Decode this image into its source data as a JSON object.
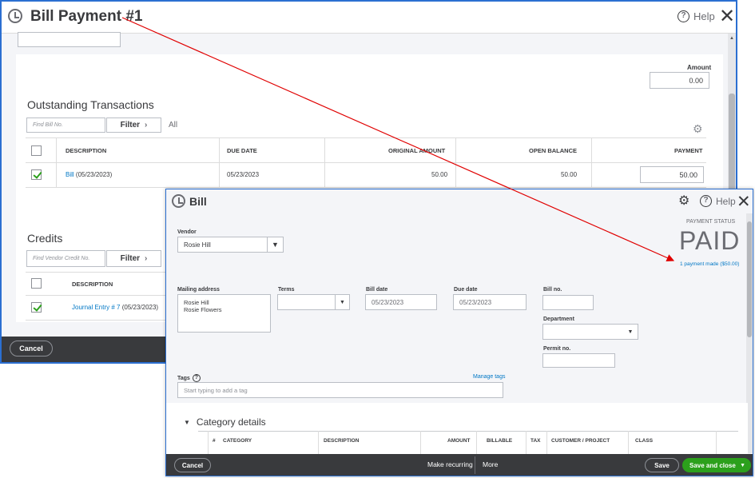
{
  "bill_payment": {
    "title": "Bill Payment #1",
    "help": "Help",
    "close": "✕",
    "amount_label": "Amount",
    "amount_value": "0.00",
    "outstanding_title": "Outstanding Transactions",
    "find_placeholder": "Find Bill No.",
    "filter": "Filter",
    "all": "All",
    "columns": [
      "DESCRIPTION",
      "DUE DATE",
      "ORIGINAL AMOUNT",
      "OPEN BALANCE",
      "PAYMENT"
    ],
    "row": {
      "link": "Bill",
      "link_date": "(05/23/2023)",
      "due": "05/23/2023",
      "original": "50.00",
      "open": "50.00",
      "payment": "50.00"
    },
    "credits_title": "Credits",
    "credit_find_placeholder": "Find Vendor Credit No.",
    "credit_filter": "Filter",
    "credit_column": "DESCRIPTION",
    "credit_row": {
      "link": "Journal Entry # 7",
      "date": "(05/23/2023)"
    },
    "cancel": "Cancel"
  },
  "bill": {
    "title": "Bill",
    "help": "Help",
    "close": "✕",
    "vendor_label": "Vendor",
    "vendor_value": "Rosie Hill",
    "payment_status_label": "PAYMENT STATUS",
    "payment_status": "PAID",
    "payment_link": "1 payment made ($50.00)",
    "mailing_label": "Mailing address",
    "mailing_lines": [
      "Rosie Hill",
      "Rosie Flowers"
    ],
    "terms_label": "Terms",
    "bill_date_label": "Bill date",
    "bill_date": "05/23/2023",
    "due_date_label": "Due date",
    "due_date": "05/23/2023",
    "bill_no_label": "Bill no.",
    "department_label": "Department",
    "permit_label": "Permit no.",
    "tags_label": "Tags",
    "manage_tags": "Manage tags",
    "tags_placeholder": "Start typing to add a tag",
    "category_title": "Category details",
    "category_columns": [
      "#",
      "CATEGORY",
      "DESCRIPTION",
      "AMOUNT",
      "BILLABLE",
      "TAX",
      "CUSTOMER / PROJECT",
      "CLASS"
    ],
    "cancel": "Cancel",
    "make_recurring": "Make recurring",
    "more": "More",
    "save": "Save",
    "save_close": "Save and close"
  },
  "colors": {
    "accent": "#2ca01c",
    "link": "#0077c5",
    "annotation_arrow": "#e00000",
    "window_border": "#2b6fd1"
  }
}
